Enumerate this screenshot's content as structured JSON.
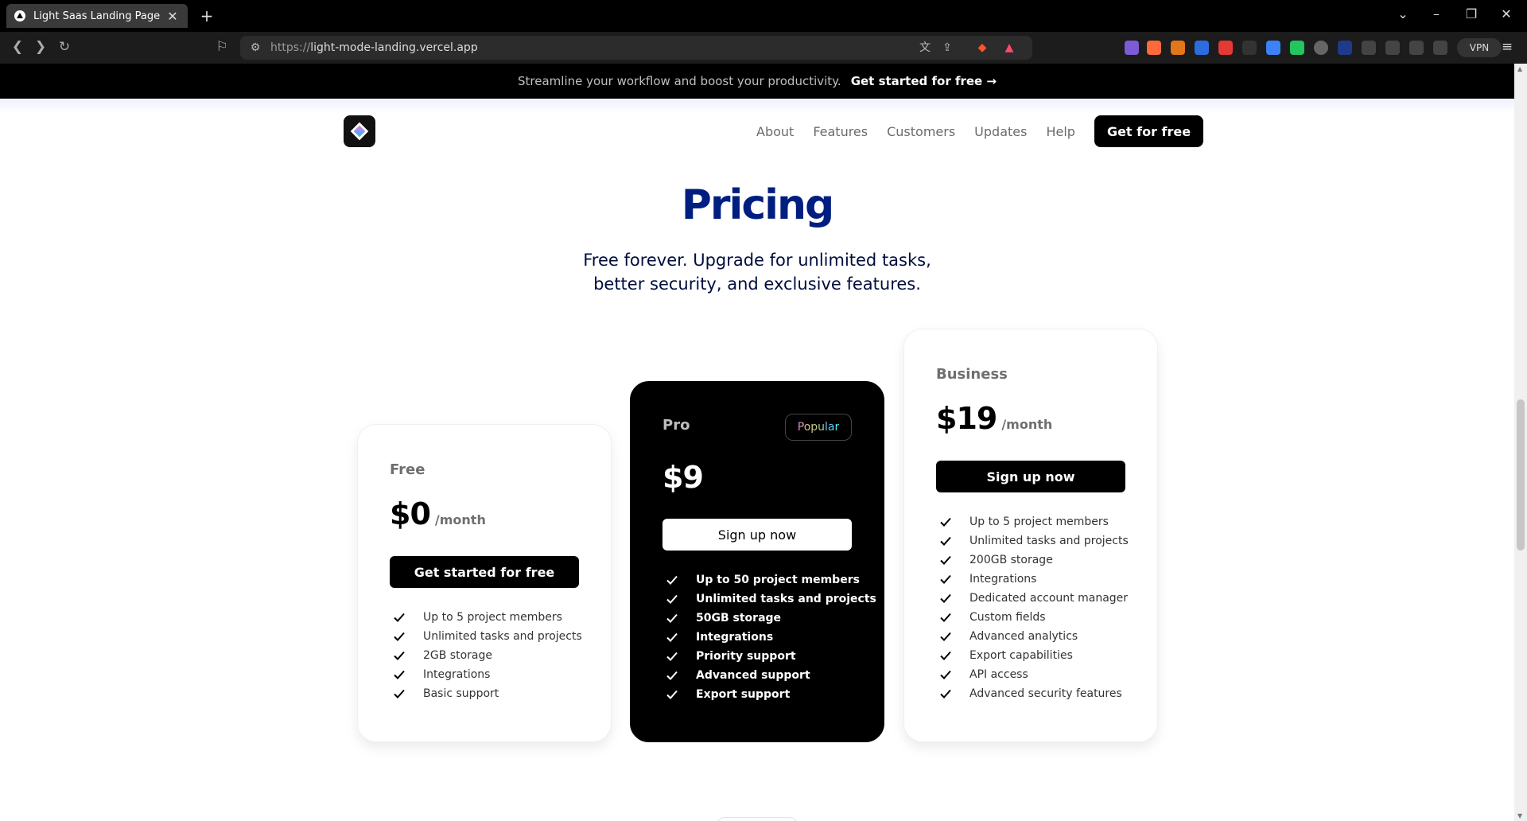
{
  "browser": {
    "tab_title": "Light Saas Landing Page",
    "url_protocol": "https://",
    "url_host": "light-mode-landing.vercel.app",
    "vpn_label": "VPN"
  },
  "banner": {
    "text": "Streamline your workflow and boost your productivity.",
    "cta": "Get started for free →"
  },
  "nav": {
    "links": [
      "About",
      "Features",
      "Customers",
      "Updates",
      "Help"
    ],
    "cta": "Get for free"
  },
  "pricing": {
    "title": "Pricing",
    "subtitle": "Free forever. Upgrade for unlimited tasks, better security, and exclusive features.",
    "plans": [
      {
        "name": "Free",
        "price": "$0",
        "per": "/month",
        "button": "Get started for free",
        "features": [
          "Up to 5 project members",
          "Unlimited tasks and projects",
          "2GB storage",
          "Integrations",
          "Basic support"
        ]
      },
      {
        "name": "Pro",
        "price": "$9",
        "badge": "Popular",
        "button": "Sign up now",
        "features": [
          "Up to 50 project members",
          "Unlimited tasks and projects",
          "50GB storage",
          "Integrations",
          "Priority support",
          "Advanced support",
          "Export support"
        ]
      },
      {
        "name": "Business",
        "price": "$19",
        "per": "/month",
        "button": "Sign up now",
        "features": [
          "Up to 5 project members",
          "Unlimited tasks and projects",
          "200GB storage",
          "Integrations",
          "Dedicated account manager",
          "Custom fields",
          "Advanced analytics",
          "Export capabilities",
          "API access",
          "Advanced security features"
        ]
      }
    ]
  }
}
